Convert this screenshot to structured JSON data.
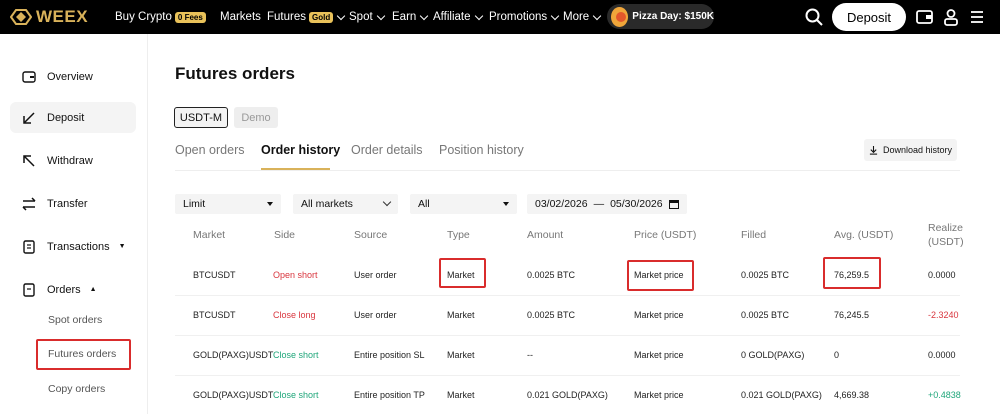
{
  "brand": {
    "name": "WEEX"
  },
  "nav": {
    "items": [
      {
        "label": "Buy Crypto",
        "badge": "0 Fees",
        "chevron": false
      },
      {
        "label": "Markets",
        "badge": "",
        "chevron": false
      },
      {
        "label": "Futures",
        "badge": "Gold",
        "chevron": true
      },
      {
        "label": "Spot",
        "badge": "",
        "chevron": true
      },
      {
        "label": "Earn",
        "badge": "",
        "chevron": true
      },
      {
        "label": "Affiliate",
        "badge": "",
        "chevron": true
      },
      {
        "label": "Promotions",
        "badge": "",
        "chevron": true
      },
      {
        "label": "More",
        "badge": "",
        "chevron": true
      }
    ],
    "promo": "Pizza Day: $150K",
    "deposit_label": "Deposit",
    "icons": [
      "search-icon",
      "wallet-icon",
      "user-icon",
      "menu-icon"
    ]
  },
  "sidebar": {
    "items": [
      {
        "label": "Overview",
        "icon": "wallet-icon",
        "active": false
      },
      {
        "label": "Deposit",
        "icon": "arrow-down-left-icon",
        "active": true
      },
      {
        "label": "Withdraw",
        "icon": "arrow-up-right-icon",
        "active": false
      },
      {
        "label": "Transfer",
        "icon": "transfer-icon",
        "active": false
      },
      {
        "label": "Transactions",
        "icon": "list-icon",
        "active": false
      },
      {
        "label": "Orders",
        "icon": "orders-icon",
        "active": false
      }
    ],
    "sub_items": [
      "Spot orders",
      "Futures orders",
      "Copy orders"
    ]
  },
  "page": {
    "title": "Futures orders",
    "segments": [
      "USDT-M",
      "Demo"
    ],
    "tabs": [
      "Open orders",
      "Order history",
      "Order details",
      "Position history"
    ],
    "active_tab": "Order history",
    "download_label": "Download history"
  },
  "filters": {
    "type": "Limit",
    "market": "All markets",
    "side": "All",
    "date_from": "03/02/2026",
    "date_sep": "—",
    "date_to": "05/30/2026"
  },
  "table": {
    "headers": [
      "Market",
      "Side",
      "Source",
      "Type",
      "Amount",
      "Price (USDT)",
      "Filled",
      "Avg. (USDT)",
      "Realize",
      "(USDT)"
    ],
    "rows": [
      {
        "market": "BTCUSDT",
        "side": "Open short",
        "side_color": "red",
        "source": "User order",
        "type": "Market",
        "amount": "0.0025 BTC",
        "price": "Market price",
        "filled": "0.0025 BTC",
        "avg": "76,259.5",
        "realized": "0.0000"
      },
      {
        "market": "BTCUSDT",
        "side": "Close long",
        "side_color": "red",
        "source": "User order",
        "type": "Market",
        "amount": "0.0025 BTC",
        "price": "Market price",
        "filled": "0.0025 BTC",
        "avg": "76,245.5",
        "realized": "-2.3240"
      },
      {
        "market": "GOLD(PAXG)USDT",
        "side": "Close short",
        "side_color": "green",
        "source": "Entire position SL",
        "type": "Market",
        "amount": "--",
        "price": "Market price",
        "filled": "0 GOLD(PAXG)",
        "avg": "0",
        "realized": "0.0000"
      },
      {
        "market": "GOLD(PAXG)USDT",
        "side": "Close short",
        "side_color": "green",
        "source": "Entire position TP",
        "type": "Market",
        "amount": "0.021 GOLD(PAXG)",
        "price": "Market price",
        "filled": "0.021 GOLD(PAXG)",
        "avg": "4,669.38",
        "realized": "+0.4838"
      }
    ]
  },
  "colors": {
    "accent": "#d9b25a",
    "loss": "#d9363e",
    "gain": "#1fa67a",
    "highlight": "#d92c2c"
  }
}
